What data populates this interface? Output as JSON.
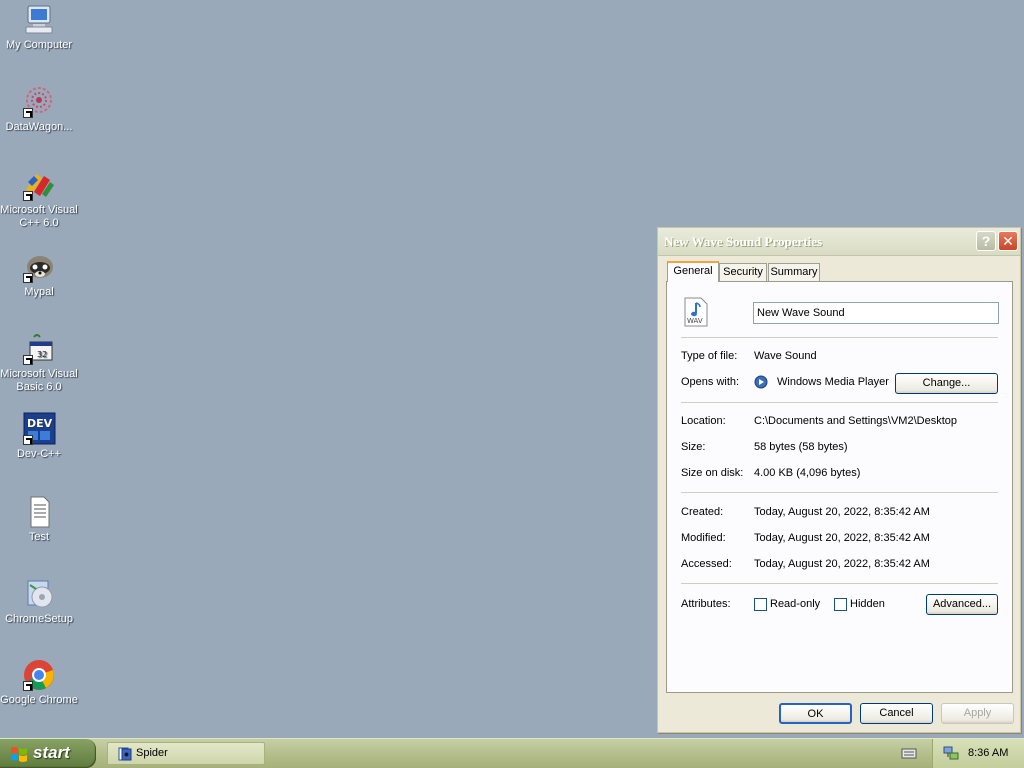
{
  "desktop": {
    "icons": [
      {
        "label": "My Computer",
        "icon": "my-computer-icon"
      },
      {
        "label": "DataWagon...",
        "icon": "datawagon-icon"
      },
      {
        "label": "Microsoft Visual C++ 6.0",
        "icon": "visual-cpp-icon"
      },
      {
        "label": "Mypal",
        "icon": "mypal-icon"
      },
      {
        "label": "Microsoft Visual Basic 6.0",
        "icon": "visual-basic-icon"
      },
      {
        "label": "Dev-C++",
        "icon": "dev-cpp-icon"
      },
      {
        "label": "Test",
        "icon": "text-file-icon"
      },
      {
        "label": "ChromeSetup",
        "icon": "chrome-setup-icon"
      },
      {
        "label": "Google Chrome",
        "icon": "google-chrome-icon"
      }
    ]
  },
  "dialog": {
    "title": "New Wave Sound Properties",
    "help_glyph": "?",
    "close_glyph": "✕",
    "tabs": [
      {
        "label": "General"
      },
      {
        "label": "Security"
      },
      {
        "label": "Summary"
      }
    ],
    "file_icon_text": "WAV",
    "file_name": "New Wave Sound",
    "type_label": "Type of file:",
    "type_value": "Wave Sound",
    "opens_label": "Opens with:",
    "opens_value": "Windows Media Player",
    "change_button": "Change...",
    "location_label": "Location:",
    "location_value": "C:\\Documents and Settings\\VM2\\Desktop",
    "size_label": "Size:",
    "size_value": "58 bytes (58 bytes)",
    "size_on_disk_label": "Size on disk:",
    "size_on_disk_value": "4.00 KB (4,096 bytes)",
    "created_label": "Created:",
    "created_value": "Today, August 20, 2022, 8:35:42 AM",
    "modified_label": "Modified:",
    "modified_value": "Today, August 20, 2022, 8:35:42 AM",
    "accessed_label": "Accessed:",
    "accessed_value": "Today, August 20, 2022, 8:35:42 AM",
    "attributes_label": "Attributes:",
    "readonly_label": "Read-only",
    "readonly_checked": false,
    "hidden_label": "Hidden",
    "hidden_checked": false,
    "advanced_button": "Advanced...",
    "ok_button": "OK",
    "cancel_button": "Cancel",
    "apply_button": "Apply"
  },
  "taskbar": {
    "start_label": "start",
    "tasks": [
      {
        "label": "Spider"
      }
    ],
    "clock": "8:36 AM"
  },
  "colors": {
    "desktop_bg": "#9aa9b9",
    "dialog_bg": "#ece9d8",
    "taskbar": "#b5bf8c",
    "start_button": "#6f8a4c"
  }
}
